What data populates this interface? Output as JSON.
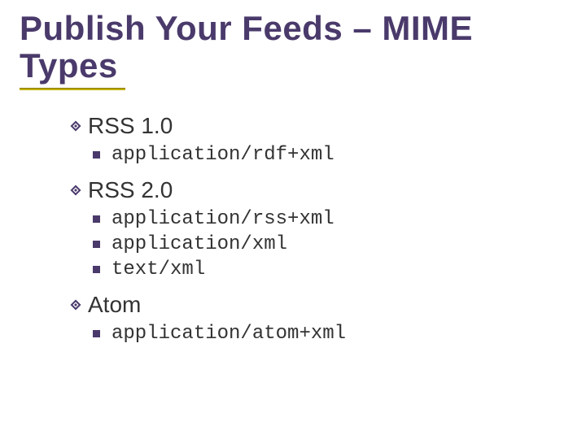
{
  "title": "Publish Your Feeds – MIME Types",
  "sections": [
    {
      "label": "RSS 1.0",
      "items": [
        "application/rdf+xml"
      ]
    },
    {
      "label": "RSS 2.0",
      "items": [
        "application/rss+xml",
        "application/xml",
        "text/xml"
      ]
    },
    {
      "label": "Atom",
      "items": [
        "application/atom+xml"
      ]
    }
  ]
}
